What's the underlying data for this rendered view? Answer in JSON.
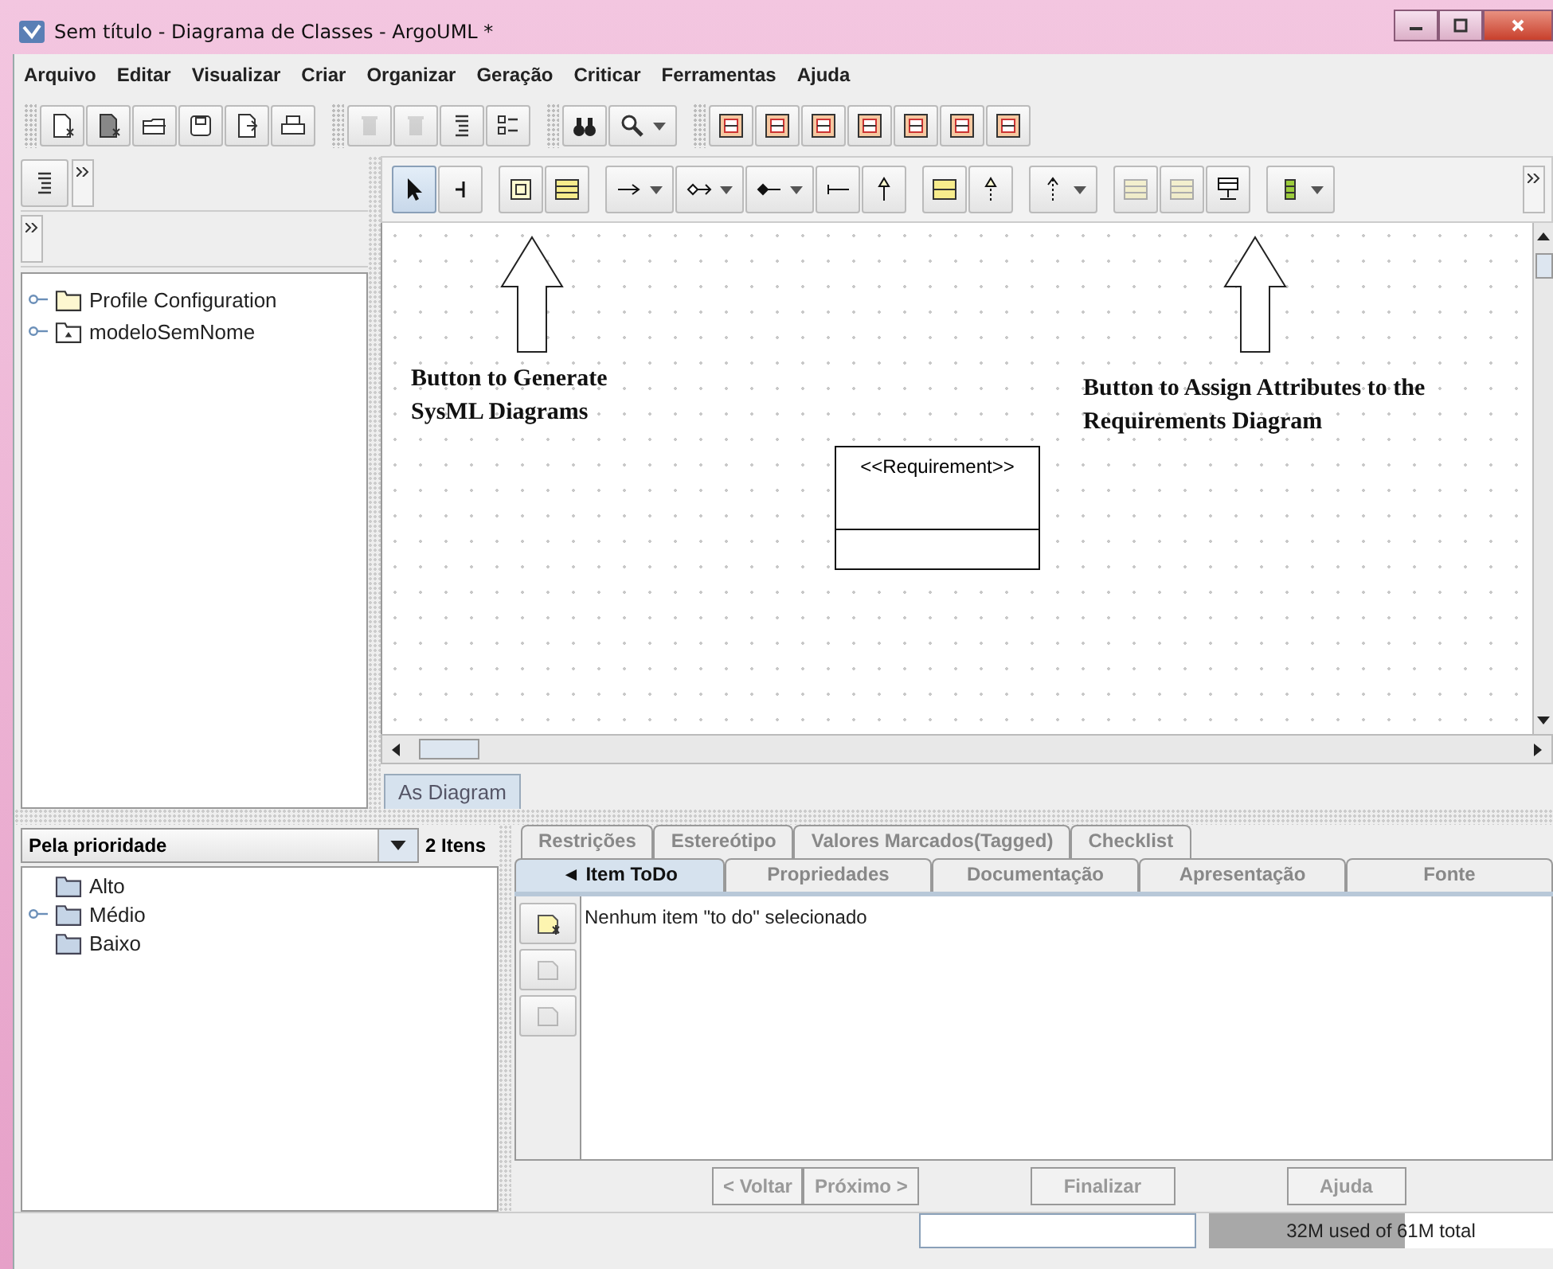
{
  "window": {
    "title": "Sem título - Diagrama de Classes - ArgoUML *"
  },
  "menu": [
    "Arquivo",
    "Editar",
    "Visualizar",
    "Criar",
    "Organizar",
    "Geração",
    "Criticar",
    "Ferramentas",
    "Ajuda"
  ],
  "toolbar": [
    [
      {
        "kind": "new-page",
        "disabled": false,
        "dropdown": false
      },
      {
        "kind": "new-page-dark",
        "disabled": false,
        "dropdown": false
      },
      {
        "kind": "folder",
        "disabled": false,
        "dropdown": false
      },
      {
        "kind": "floppy",
        "disabled": false,
        "dropdown": false
      },
      {
        "kind": "page-export",
        "disabled": false,
        "dropdown": false
      },
      {
        "kind": "printer",
        "disabled": false,
        "dropdown": false
      }
    ],
    [
      {
        "kind": "trash",
        "disabled": true,
        "dropdown": false
      },
      {
        "kind": "bin",
        "disabled": true,
        "dropdown": false
      },
      {
        "kind": "lines",
        "disabled": false,
        "dropdown": false
      },
      {
        "kind": "checklist",
        "disabled": false,
        "dropdown": false
      }
    ],
    [
      {
        "kind": "binoculars",
        "disabled": false,
        "dropdown": false
      },
      {
        "kind": "magnifier",
        "disabled": false,
        "dropdown": true
      }
    ],
    [
      {
        "kind": "diagram",
        "disabled": false,
        "dropdown": false
      },
      {
        "kind": "diagram",
        "disabled": false,
        "dropdown": false
      },
      {
        "kind": "diagram",
        "disabled": false,
        "dropdown": false
      },
      {
        "kind": "diagram",
        "disabled": false,
        "dropdown": false
      },
      {
        "kind": "diagram",
        "disabled": false,
        "dropdown": false
      },
      {
        "kind": "diagram",
        "disabled": false,
        "dropdown": false
      },
      {
        "kind": "diagram",
        "disabled": false,
        "dropdown": false
      }
    ]
  ],
  "explorer": {
    "tree": [
      {
        "label": "Profile Configuration",
        "kind": "folder",
        "expandable": true
      },
      {
        "label": "modeloSemNome",
        "kind": "package",
        "expandable": true
      }
    ]
  },
  "diagram_toolbar": [
    [
      {
        "kind": "cursor",
        "selected": true,
        "disabled": false,
        "dropdown": false
      },
      {
        "kind": "tee",
        "selected": false,
        "disabled": false,
        "dropdown": false
      }
    ],
    [
      {
        "kind": "requirement",
        "selected": false,
        "disabled": false,
        "dropdown": false
      },
      {
        "kind": "class",
        "selected": false,
        "disabled": false,
        "dropdown": false
      }
    ],
    [
      {
        "kind": "arrow",
        "selected": false,
        "disabled": false,
        "dropdown": true
      },
      {
        "kind": "diamond-arrow",
        "selected": false,
        "disabled": false,
        "dropdown": true
      },
      {
        "kind": "filled-diamond",
        "selected": false,
        "disabled": false,
        "dropdown": true
      },
      {
        "kind": "bar-line",
        "selected": false,
        "disabled": false,
        "dropdown": false
      },
      {
        "kind": "triangle-arrow",
        "selected": false,
        "disabled": false,
        "dropdown": false
      }
    ],
    [
      {
        "kind": "box",
        "selected": false,
        "disabled": false,
        "dropdown": false
      },
      {
        "kind": "dashed-triangle",
        "selected": false,
        "disabled": false,
        "dropdown": false
      }
    ],
    [
      {
        "kind": "dashed-arrow",
        "selected": false,
        "disabled": false,
        "dropdown": true
      }
    ],
    [
      {
        "kind": "class",
        "selected": false,
        "disabled": true,
        "dropdown": false
      },
      {
        "kind": "class",
        "selected": false,
        "disabled": true,
        "dropdown": false
      },
      {
        "kind": "stand",
        "selected": false,
        "disabled": false,
        "dropdown": false
      }
    ],
    [
      {
        "kind": "green-class",
        "selected": false,
        "disabled": false,
        "dropdown": true
      }
    ]
  ],
  "canvas": {
    "annotations": [
      {
        "text": "Button to Generate SysML Diagrams"
      },
      {
        "text": "Button to Assign Attributes to the Requirements Diagram"
      }
    ],
    "element": {
      "stereotype": "<<Requirement>>"
    },
    "tab": "As Diagram"
  },
  "todo": {
    "sort": "Pela prioridade",
    "count": "2 Itens",
    "tree": [
      {
        "label": "Alto",
        "expandable": false
      },
      {
        "label": "Médio",
        "expandable": true
      },
      {
        "label": "Baixo",
        "expandable": false
      }
    ]
  },
  "details": {
    "tabs_back": [
      {
        "label": "Restrições",
        "selected": false
      },
      {
        "label": "Estereótipo",
        "selected": false
      },
      {
        "label": "Valores Marcados(Tagged)",
        "selected": false
      },
      {
        "label": "Checklist",
        "selected": false
      }
    ],
    "tabs_front": [
      {
        "label": "◄ Item ToDo",
        "selected": true
      },
      {
        "label": "Propriedades",
        "selected": false
      },
      {
        "label": "Documentação",
        "selected": false
      },
      {
        "label": "Apresentação",
        "selected": false
      },
      {
        "label": "Fonte",
        "selected": false
      }
    ],
    "tools": [
      {
        "kind": "new-page",
        "disabled": false
      },
      {
        "kind": "page",
        "disabled": true
      },
      {
        "kind": "page",
        "disabled": true
      }
    ],
    "message": "Nenhum item \"to do\" selecionado",
    "buttons": [
      {
        "label": "< Voltar",
        "disabled": true
      },
      {
        "label": "Próximo >",
        "disabled": true
      },
      {
        "label": "Finalizar",
        "disabled": true
      },
      {
        "label": "Ajuda",
        "disabled": true
      }
    ]
  },
  "status_bar": {
    "memory": {
      "text": "32M used of 61M total",
      "level": 0.57
    }
  }
}
